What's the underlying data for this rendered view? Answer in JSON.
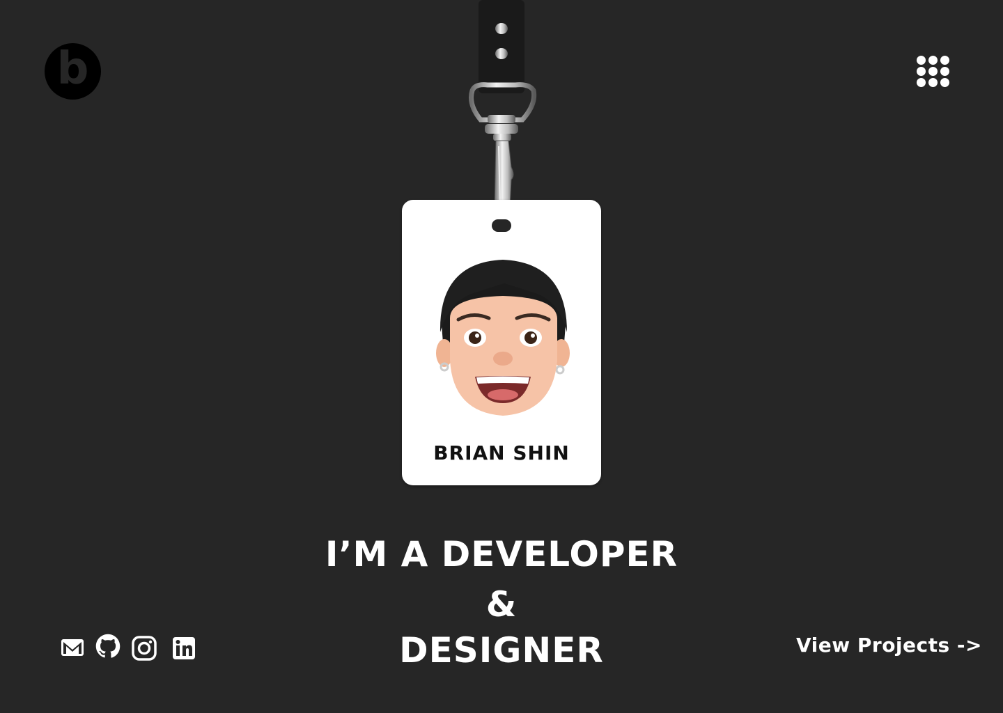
{
  "header": {
    "logo_letter": "b"
  },
  "badge": {
    "name": "BRIAN SHIN"
  },
  "hero": {
    "line1": "I’M A DEVELOPER",
    "line2": "&",
    "line3": "DESIGNER"
  },
  "socials": [
    {
      "icon": "mail-icon"
    },
    {
      "icon": "github-icon"
    },
    {
      "icon": "instagram-icon"
    },
    {
      "icon": "linkedin-icon"
    }
  ],
  "cta": {
    "view_projects": "View Projects ->"
  },
  "colors": {
    "background": "#262626",
    "text": "#ffffff",
    "badge": "#ffffff"
  }
}
